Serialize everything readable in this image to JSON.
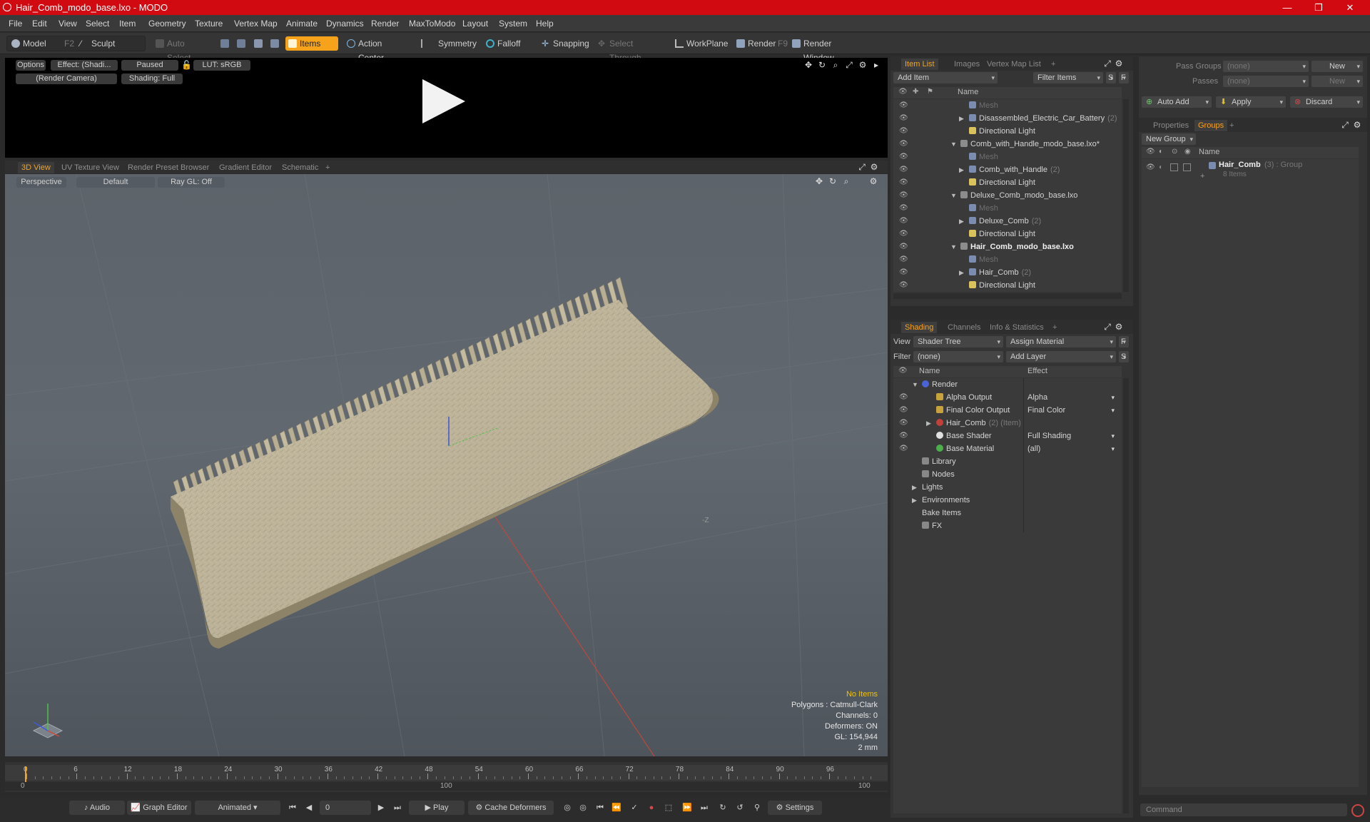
{
  "window": {
    "title": "Hair_Comb_modo_base.lxo - MODO",
    "min": "—",
    "max": "❐",
    "close": "✕"
  },
  "menu": [
    "File",
    "Edit",
    "View",
    "Select",
    "Item",
    "Geometry",
    "Texture",
    "Vertex Map",
    "Animate",
    "Dynamics",
    "Render",
    "MaxToModo",
    "Layout",
    "System",
    "Help"
  ],
  "toolbar": {
    "model": "Model",
    "model_key": "F2",
    "sculpt": "Sculpt",
    "auto_select": "Auto Select",
    "items": "Items",
    "action_center": "Action Center",
    "symmetry": "Symmetry",
    "falloff": "Falloff",
    "snapping": "Snapping",
    "select_through": "Select Through",
    "workplane": "WorkPlane",
    "render": "Render",
    "render_key": "F9",
    "render_window": "Render Window"
  },
  "render_view": {
    "options": "Options",
    "effect": "Effect: (Shadi...",
    "paused": "Paused",
    "lut": "LUT: sRGB",
    "camera": "(Render Camera)",
    "shading": "Shading: Full"
  },
  "viewport_tabs": [
    "3D View",
    "UV Texture View",
    "Render Preset Browser",
    "Gradient Editor",
    "Schematic",
    "+"
  ],
  "viewport": {
    "perspective": "Perspective",
    "default": "Default",
    "raygl": "Ray GL: Off",
    "axis_label": "-Z",
    "info": {
      "no_items": "No Items",
      "polygons": "Polygons : Catmull-Clark",
      "channels": "Channels: 0",
      "deformers": "Deformers: ON",
      "gl": "GL: 154,944",
      "scale": "2 mm"
    }
  },
  "timeline": {
    "ticks": [
      "0",
      "6",
      "12",
      "18",
      "24",
      "30",
      "36",
      "42",
      "48",
      "54",
      "60",
      "66",
      "72",
      "78",
      "84",
      "90",
      "96"
    ],
    "start": "0",
    "mid": "100",
    "end": "100"
  },
  "bottombar": {
    "audio": "Audio",
    "graph_editor": "Graph Editor",
    "animated": "Animated",
    "frame": "0",
    "play": "Play",
    "cache": "Cache Deformers",
    "settings": "Settings"
  },
  "item_list": {
    "tabs": [
      "Item List",
      "Images",
      "Vertex Map List",
      "+"
    ],
    "add_item": "Add Item",
    "filter_items": "Filter Items",
    "s": "S",
    "f": "F",
    "col_name": "Name",
    "rows": [
      {
        "label": "Mesh",
        "count": "",
        "indent": 2,
        "style": "dim"
      },
      {
        "label": "Disassembled_Electric_Car_Battery",
        "count": "(2)",
        "indent": 2,
        "style": "normal"
      },
      {
        "label": "Directional Light",
        "count": "",
        "indent": 2,
        "style": "normal"
      },
      {
        "label": "Comb_with_Handle_modo_base.lxo*",
        "count": "",
        "indent": 1,
        "style": "normal"
      },
      {
        "label": "Mesh",
        "count": "",
        "indent": 2,
        "style": "dim"
      },
      {
        "label": "Comb_with_Handle",
        "count": "(2)",
        "indent": 2,
        "style": "normal"
      },
      {
        "label": "Directional Light",
        "count": "",
        "indent": 2,
        "style": "normal"
      },
      {
        "label": "Deluxe_Comb_modo_base.lxo",
        "count": "",
        "indent": 1,
        "style": "normal"
      },
      {
        "label": "Mesh",
        "count": "",
        "indent": 2,
        "style": "dim"
      },
      {
        "label": "Deluxe_Comb",
        "count": "(2)",
        "indent": 2,
        "style": "normal"
      },
      {
        "label": "Directional Light",
        "count": "",
        "indent": 2,
        "style": "normal"
      },
      {
        "label": "Hair_Comb_modo_base.lxo",
        "count": "",
        "indent": 1,
        "style": "bold"
      },
      {
        "label": "Mesh",
        "count": "",
        "indent": 2,
        "style": "dim"
      },
      {
        "label": "Hair_Comb",
        "count": "(2)",
        "indent": 2,
        "style": "normal"
      },
      {
        "label": "Directional Light",
        "count": "",
        "indent": 2,
        "style": "normal"
      }
    ]
  },
  "shading": {
    "tabs": [
      "Shading",
      "Channels",
      "Info & Statistics",
      "+"
    ],
    "view_label": "View",
    "view_value": "Shader Tree",
    "assign_material": "Assign Material",
    "filter_label": "Filter",
    "filter_value": "(none)",
    "add_layer": "Add Layer",
    "col_name": "Name",
    "col_effect": "Effect",
    "rows": [
      {
        "label": "Render",
        "effect": "",
        "indent": 0,
        "count": ""
      },
      {
        "label": "Alpha Output",
        "effect": "Alpha",
        "indent": 1,
        "count": ""
      },
      {
        "label": "Final Color Output",
        "effect": "Final Color",
        "indent": 1,
        "count": ""
      },
      {
        "label": "Hair_Comb",
        "effect": "",
        "indent": 1,
        "count": "(2) (Item)"
      },
      {
        "label": "Base Shader",
        "effect": "Full Shading",
        "indent": 1,
        "count": ""
      },
      {
        "label": "Base Material",
        "effect": "(all)",
        "indent": 1,
        "count": ""
      },
      {
        "label": "Library",
        "effect": "",
        "indent": 0,
        "count": ""
      },
      {
        "label": "Nodes",
        "effect": "",
        "indent": 0,
        "count": ""
      },
      {
        "label": "Lights",
        "effect": "",
        "indent": 0,
        "count": ""
      },
      {
        "label": "Environments",
        "effect": "",
        "indent": 0,
        "count": ""
      },
      {
        "label": "Bake Items",
        "effect": "",
        "indent": 0,
        "count": ""
      },
      {
        "label": "FX",
        "effect": "",
        "indent": 0,
        "count": ""
      }
    ]
  },
  "groups": {
    "pass_groups": "Pass Groups",
    "pass_groups_value": "(none)",
    "new": "New",
    "passes": "Passes",
    "passes_value": "(none)",
    "new2": "New",
    "auto_add": "Auto Add",
    "apply": "Apply",
    "discard": "Discard",
    "tabs": [
      "Properties",
      "Groups",
      "+"
    ],
    "new_group": "New Group",
    "col_name": "Name",
    "group_name": "Hair_Comb",
    "group_count": "(3) : Group",
    "group_items": "8 Items"
  },
  "command": {
    "placeholder": "Command"
  },
  "colors": {
    "accent": "#f7a21b",
    "title": "#d10a12"
  }
}
